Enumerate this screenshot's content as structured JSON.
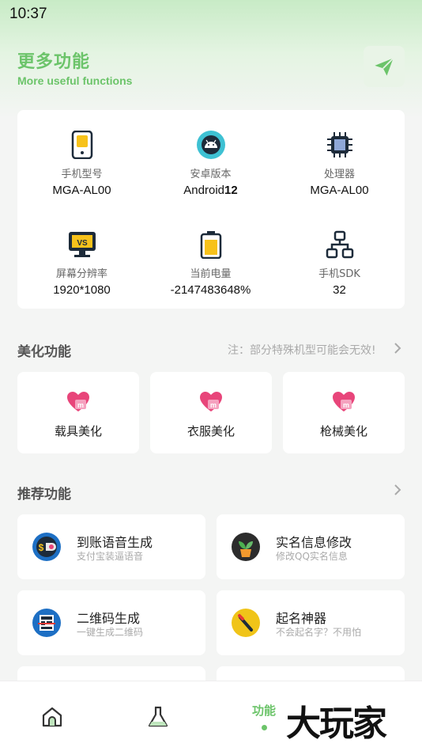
{
  "status_bar": {
    "time": "10:37"
  },
  "header": {
    "title": "更多功能",
    "subtitle": "More useful functions"
  },
  "device_info": [
    {
      "icon": "phone-icon",
      "label": "手机型号",
      "value": "MGA-AL00"
    },
    {
      "icon": "android-icon",
      "label": "安卓版本",
      "value_prefix": "Android",
      "value_bold": "12"
    },
    {
      "icon": "cpu-icon",
      "label": "处理器",
      "value": "MGA-AL00"
    },
    {
      "icon": "monitor-icon",
      "label": "屏幕分辨率",
      "value": "1920*1080"
    },
    {
      "icon": "battery-icon",
      "label": "当前电量",
      "value": "-2147483648%"
    },
    {
      "icon": "network-icon",
      "label": "手机SDK",
      "value": "32"
    }
  ],
  "beauty_section": {
    "title": "美化功能",
    "note": "注：部分特殊机型可能会无效!",
    "items": [
      {
        "icon": "heart-m-icon",
        "label": "载具美化"
      },
      {
        "icon": "heart-m-icon",
        "label": "衣服美化"
      },
      {
        "icon": "heart-m-icon",
        "label": "枪械美化"
      }
    ]
  },
  "recommend_section": {
    "title": "推荐功能",
    "items": [
      {
        "icon": "alipay-voice-icon",
        "title": "到账语音生成",
        "subtitle": "支付宝装逼语音"
      },
      {
        "icon": "plant-icon",
        "title": "实名信息修改",
        "subtitle": "修改QQ实名信息"
      },
      {
        "icon": "qrcode-icon",
        "title": "二维码生成",
        "subtitle": "一键生成二维码"
      },
      {
        "icon": "pen-icon",
        "title": "起名神器",
        "subtitle": "不会起名字？不用怕"
      }
    ]
  },
  "bottom_nav": {
    "items": [
      {
        "icon": "home-icon",
        "label": ""
      },
      {
        "icon": "flask-icon",
        "label": ""
      },
      {
        "icon": "",
        "label": "功能",
        "active": true
      }
    ]
  },
  "watermark": "大玩家",
  "colors": {
    "accent": "#6cc46a",
    "heart": "#e8457a"
  }
}
